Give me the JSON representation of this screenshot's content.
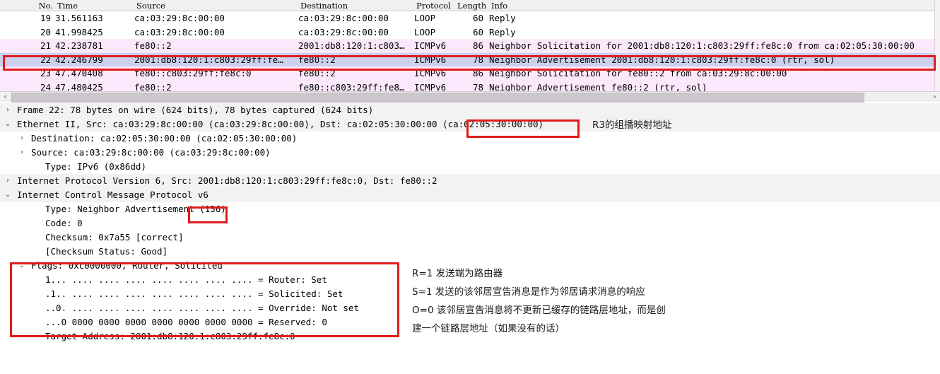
{
  "packet_list": {
    "columns": [
      {
        "key": "no",
        "label": "No."
      },
      {
        "key": "time",
        "label": "Time"
      },
      {
        "key": "src",
        "label": "Source"
      },
      {
        "key": "dst",
        "label": "Destination"
      },
      {
        "key": "proto",
        "label": "Protocol"
      },
      {
        "key": "len",
        "label": "Length"
      },
      {
        "key": "info",
        "label": "Info"
      }
    ],
    "rows": [
      {
        "no": "19",
        "time": "31.561163",
        "src": "ca:03:29:8c:00:00",
        "dst": "ca:03:29:8c:00:00",
        "proto": "LOOP",
        "len": "60",
        "info": "Reply",
        "style": "white"
      },
      {
        "no": "20",
        "time": "41.998425",
        "src": "ca:03:29:8c:00:00",
        "dst": "ca:03:29:8c:00:00",
        "proto": "LOOP",
        "len": "60",
        "info": "Reply",
        "style": "white"
      },
      {
        "no": "21",
        "time": "42.238781",
        "src": "fe80::2",
        "dst": "2001:db8:120:1:c803…",
        "proto": "ICMPv6",
        "len": "86",
        "info": "Neighbor Solicitation for 2001:db8:120:1:c803:29ff:fe8c:0 from ca:02:05:30:00:00",
        "style": "icmpv6"
      },
      {
        "no": "22",
        "time": "42.246799",
        "src": "2001:db8:120:1:c803:29ff:fe…",
        "dst": "fe80::2",
        "proto": "ICMPv6",
        "len": "78",
        "info": "Neighbor Advertisement 2001:db8:120:1:c803:29ff:fe8c:0 (rtr, sol)",
        "style": "selected"
      },
      {
        "no": "23",
        "time": "47.470408",
        "src": "fe80::c803:29ff:fe8c:0",
        "dst": "fe80::2",
        "proto": "ICMPv6",
        "len": "86",
        "info": "Neighbor Solicitation for fe80::2 from ca:03:29:8c:00:00",
        "style": "icmpv6"
      },
      {
        "no": "24",
        "time": "47.480425",
        "src": "fe80::2",
        "dst": "fe80::c803:29ff:fe8…",
        "proto": "ICMPv6",
        "len": "78",
        "info": "Neighbor Advertisement fe80::2 (rtr, sol)",
        "style": "icmpv6"
      }
    ],
    "hscroll": {
      "left_arrow": "‹",
      "right_arrow": "›"
    }
  },
  "detail_tree": {
    "rows": [
      {
        "level": 0,
        "twist": "›",
        "text": "Frame 22: 78 bytes on wire (624 bits), 78 bytes captured (624 bits)",
        "shade": true
      },
      {
        "level": 0,
        "twist": "⌄",
        "text": "Ethernet II, Src: ca:03:29:8c:00:00 (ca:03:29:8c:00:00), Dst: ca:02:05:30:00:00 (ca:02:05:30:00:00)",
        "shade": true
      },
      {
        "level": 1,
        "twist": "›",
        "text": "Destination: ca:02:05:30:00:00 (ca:02:05:30:00:00)",
        "shade": false
      },
      {
        "level": 1,
        "twist": "›",
        "text": "Source: ca:03:29:8c:00:00 (ca:03:29:8c:00:00)",
        "shade": false
      },
      {
        "level": 2,
        "twist": "",
        "text": "Type: IPv6 (0x86dd)",
        "shade": false
      },
      {
        "level": 0,
        "twist": "›",
        "text": "Internet Protocol Version 6, Src: 2001:db8:120:1:c803:29ff:fe8c:0, Dst: fe80::2",
        "shade": true
      },
      {
        "level": 0,
        "twist": "⌄",
        "text": "Internet Control Message Protocol v6",
        "shade": true
      },
      {
        "level": 2,
        "twist": "",
        "text": "Type: Neighbor Advertisement (136)",
        "shade": false
      },
      {
        "level": 2,
        "twist": "",
        "text": "Code: 0",
        "shade": false
      },
      {
        "level": 2,
        "twist": "",
        "text": "Checksum: 0x7a55 [correct]",
        "shade": false
      },
      {
        "level": 2,
        "twist": "",
        "text": "[Checksum Status: Good]",
        "shade": false
      },
      {
        "level": 1,
        "twist": "⌄",
        "text": "Flags: 0xc0000000, Router, Solicited",
        "shade": false
      },
      {
        "level": 2,
        "twist": "",
        "text": "1... .... .... .... .... .... .... .... = Router: Set",
        "shade": false
      },
      {
        "level": 2,
        "twist": "",
        "text": ".1.. .... .... .... .... .... .... .... = Solicited: Set",
        "shade": false
      },
      {
        "level": 2,
        "twist": "",
        "text": "..0. .... .... .... .... .... .... .... = Override: Not set",
        "shade": false
      },
      {
        "level": 2,
        "twist": "",
        "text": "...0 0000 0000 0000 0000 0000 0000 0000 = Reserved: 0",
        "shade": false
      },
      {
        "level": 2,
        "twist": "",
        "text": "Target Address: 2001:db8:120:1:c803:29ff:fe8c:0",
        "shade": false
      }
    ]
  },
  "annotations": {
    "mac_note": "R3的组播映射地址",
    "flag_notes": [
      "R=1 发送端为路由器",
      "S=1 发送的该邻居宣告消息是作为邻居请求消息的响应",
      "O=0 该邻居宣告消息将不更新已缓存的链路层地址，而是创",
      "建一个链路层地址（如果没有的话）"
    ],
    "highlight_color": "#e01b1b"
  }
}
